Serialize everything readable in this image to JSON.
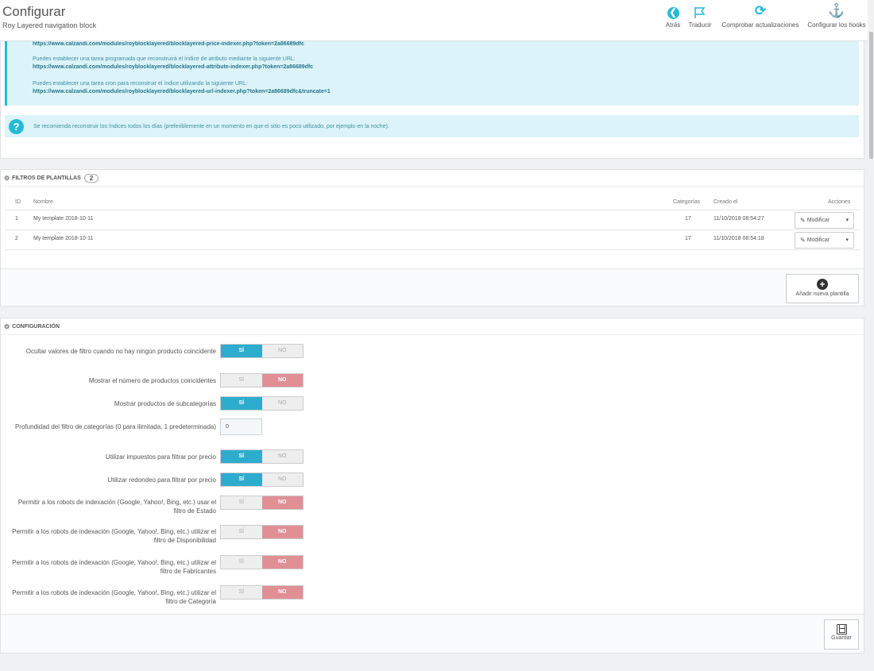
{
  "header": {
    "title": "Configurar",
    "subtitle": "Roy Layered navigation block",
    "toolbar": [
      {
        "label": "Atrás",
        "icon": "back-icon"
      },
      {
        "label": "Traducir",
        "icon": "flag-icon"
      },
      {
        "label": "Comprobar actualizaciones",
        "icon": "refresh-icon"
      },
      {
        "label": "Configurar los hooks",
        "icon": "anchor-icon"
      }
    ]
  },
  "info": {
    "line1_url": "https://www.calzandi.com/modules/royblocklayered/blocklayered-price-indexer.php?token=2a86689dfc",
    "line2_text": "Puedes establecer una tarea programada que reconstruirá el índice de atributo mediante la siguiente URL:",
    "line2_url": "https://www.calzandi.com/modules/royblocklayered/blocklayered-attribute-indexer.php?token=2a86689dfc",
    "line3_text": "Puedes establecer una tarea cron para reconstruir el índice utilizando la siguiente URL:",
    "line3_url": "https://www.calzandi.com/modules/royblocklayered/blocklayered-url-indexer.php?token=2a86689dfc&truncate=1",
    "tip": "Se recomienda reconstruir los índices todos los días (preferiblemente en un momento en que el sitio es poco utilizado, por ejemplo en la noche)."
  },
  "templates": {
    "heading": "FILTROS DE PLANTILLAS",
    "count": "2",
    "columns": {
      "id": "ID",
      "name": "Nombre",
      "categories": "Categorías",
      "created": "Creado el",
      "actions": "Acciones"
    },
    "rows": [
      {
        "id": "1",
        "name": "My template 2018-10-11",
        "categories": "17",
        "created": "11/10/2018 08:54:27",
        "action": "Modificar"
      },
      {
        "id": "2",
        "name": "My template 2018-10-11",
        "categories": "17",
        "created": "11/10/2018 08:54:18",
        "action": "Modificar"
      }
    ],
    "add_label": "Añadir nueva plantilla"
  },
  "config": {
    "heading": "CONFIGURACIÓN",
    "yes": "SÍ",
    "no": "NO",
    "fields": [
      {
        "label": "Ocultar valores de filtro cuando no hay ningún producto coincidente",
        "value": "yes"
      },
      {
        "label": "Mostrar el número de productos coincidentes",
        "value": "no"
      },
      {
        "label": "Mostrar productos de subcategorías",
        "value": "yes"
      },
      {
        "label": "Profundidad del filtro de categorías (0 para ilimitada, 1 predeterminada)",
        "value": "0"
      },
      {
        "label": "Utilizar impuestos para filtrar por precio",
        "value": "yes"
      },
      {
        "label": "Utilizar redondeo para filtrar por precio",
        "value": "yes"
      },
      {
        "label": "Permitir a los robots de indexación (Google, Yahoo!, Bing, etc.) usar el filtro de Estado",
        "value": "no"
      },
      {
        "label": "Permitir a los robots de indexación (Google, Yahoo!, Bing, etc.) utilizar el filtro de Disponibilidad",
        "value": "no"
      },
      {
        "label": "Permitir a los robots de indexación (Google, Yahoo!, Bing, etc.) utilizar el filtro de Fabricantes",
        "value": "no"
      },
      {
        "label": "Permitir a los robots de indexación (Google, Yahoo!, Bing, etc.) utilizar el filtro de Categoría",
        "value": "no"
      }
    ],
    "save_label": "Guardar"
  },
  "colors": {
    "accent": "#25b9d7",
    "yes_on": "#2eacce",
    "no_on": "#e08f95",
    "info_bg": "#dcf4f9"
  }
}
